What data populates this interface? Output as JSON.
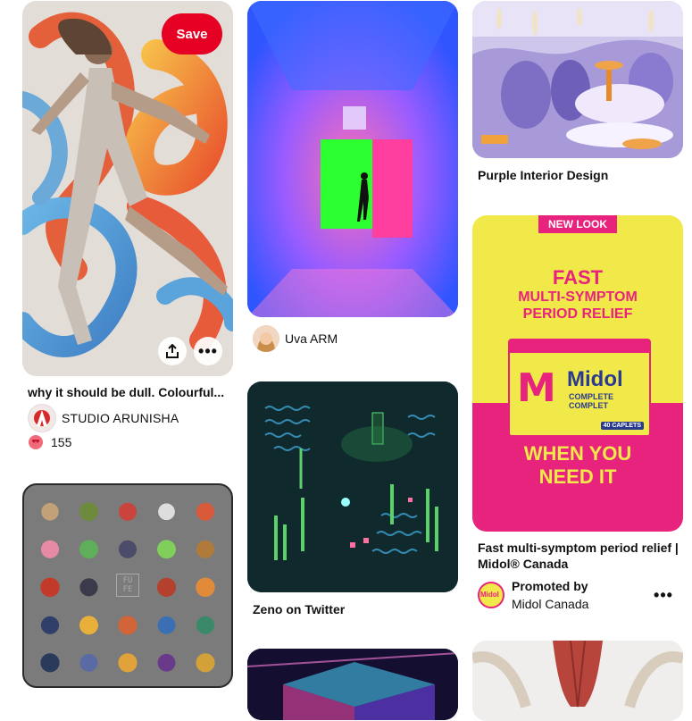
{
  "colors": {
    "save": "#e60023",
    "ad_pink": "#e8237d",
    "ad_yellow": "#f1e84a"
  },
  "pins": {
    "pin1": {
      "save_label": "Save",
      "title": "why it should be dull. Colourful...",
      "author": "STUDIO ARUNISHA",
      "avatar_letter": "A",
      "reactions": "155",
      "share_icon": "share-icon",
      "more_icon": "more-icon"
    },
    "pin2": {
      "author": "Uva ARM"
    },
    "pin3": {
      "title": "Purple Interior Design"
    },
    "pin4": {
      "badge": "NEW LOOK",
      "headline_1": "FAST",
      "headline_2": "MULTI-SYMPTOM",
      "headline_3": "PERIOD RELIEF",
      "box_brand": "Midol",
      "box_sub": "COMPLETE",
      "box_sub2": "COMPLET",
      "box_letter": "M",
      "box_count": "40 CAPLETS",
      "tagline_1": "WHEN YOU",
      "tagline_2": "NEED IT",
      "title": "Fast multi-symptom period relief | Midol® Canada",
      "promoted_label": "Promoted by",
      "advertiser": "Midol Canada",
      "avatar_text": "Midol"
    },
    "pin5": {
      "title": "Zeno on Twitter"
    },
    "pin6": {
      "center_label": "FU FE"
    }
  }
}
